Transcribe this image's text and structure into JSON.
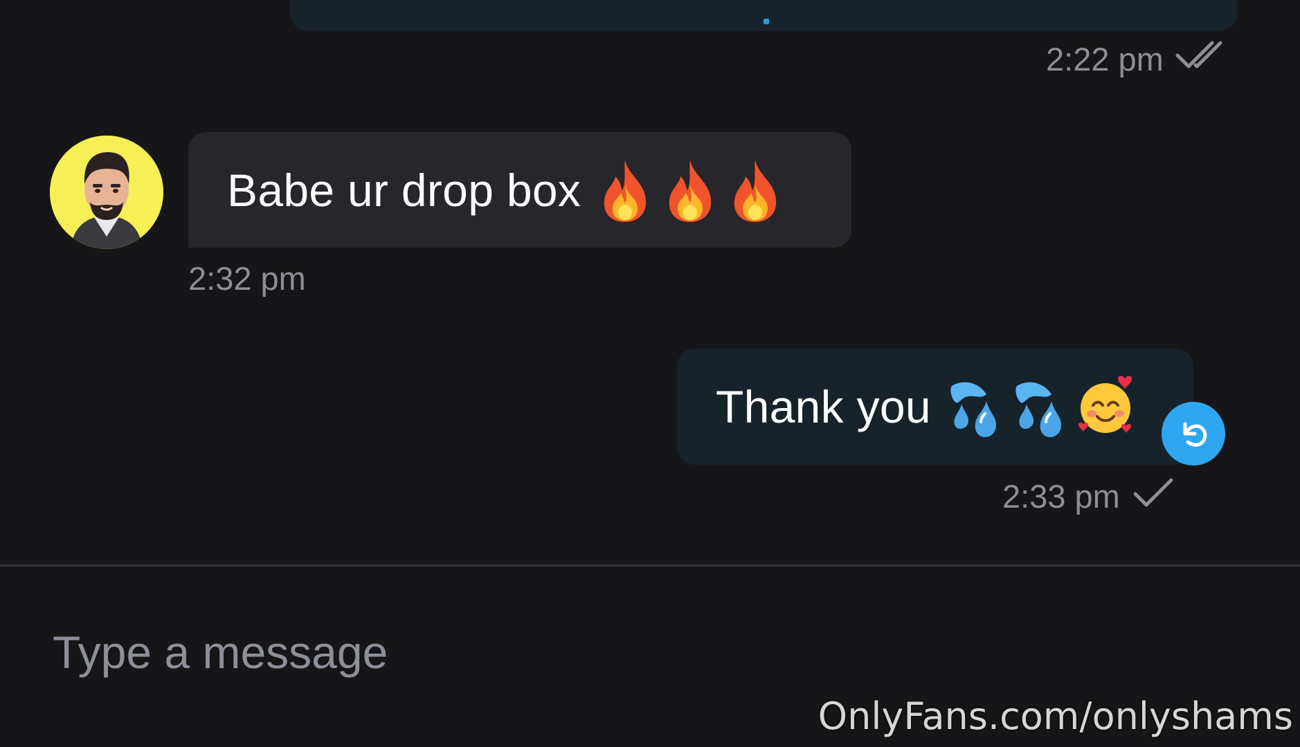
{
  "colors": {
    "background": "#161618",
    "incoming_bubble": "#26262b",
    "outgoing_bubble": "#17232b",
    "timestamp": "#8e8e95",
    "reply_button": "#2ea7f0",
    "placeholder": "#8d9099",
    "avatar_background": "#f6ef56"
  },
  "messages": [
    {
      "direction": "outgoing",
      "text": "",
      "time": "2:22 pm",
      "status_icon": "double-check-icon"
    },
    {
      "direction": "incoming",
      "text": "Babe ur drop box",
      "emojis": [
        "fire-emoji",
        "fire-emoji",
        "fire-emoji"
      ],
      "time": "2:32 pm",
      "avatar_icon": "bitmoji-avatar-icon"
    },
    {
      "direction": "outgoing",
      "text": "Thank you",
      "emojis": [
        "sweat-droplets-emoji",
        "sweat-droplets-emoji",
        "smiling-face-with-hearts-emoji"
      ],
      "time": "2:33 pm",
      "status_icon": "single-check-icon",
      "action_icon": "reply-icon"
    }
  ],
  "composer": {
    "placeholder": "Type a message",
    "value": ""
  },
  "watermark": "OnlyFans.com/onlyshams"
}
